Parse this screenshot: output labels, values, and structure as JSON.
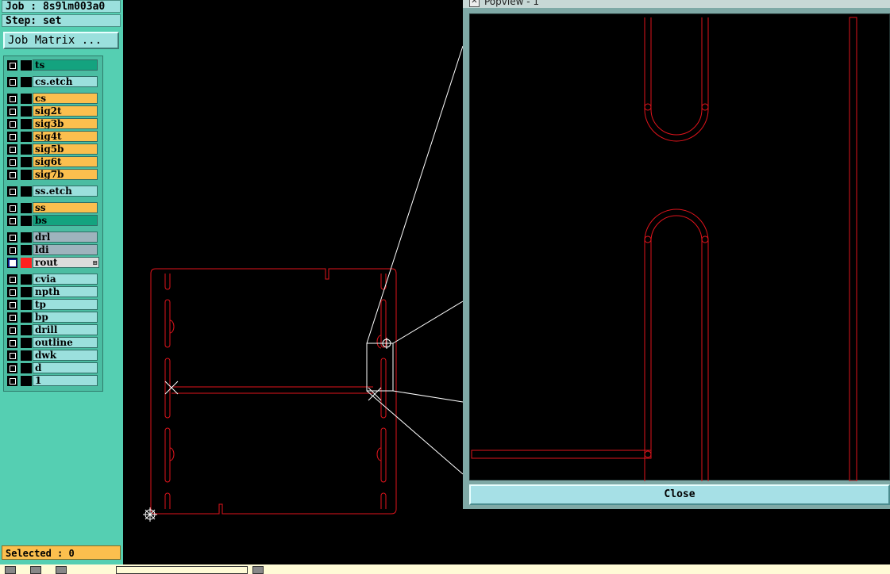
{
  "left_panel": {
    "job_label": "Job : 8s9lm003a0",
    "step_label": "Step: set",
    "job_matrix_label": "Job Matrix ...",
    "selected_label": "Selected : 0"
  },
  "layers": [
    {
      "name": "ts",
      "color": "#14a37f",
      "active": false
    },
    {
      "name": "cs.etch",
      "color": "#9be0dd",
      "active": false
    },
    {
      "name": "cs",
      "color": "#fbbf4e",
      "active": false
    },
    {
      "name": "sig2t",
      "color": "#fbbf4e",
      "active": false
    },
    {
      "name": "sig3b",
      "color": "#fbbf4e",
      "active": false
    },
    {
      "name": "sig4t",
      "color": "#fbbf4e",
      "active": false
    },
    {
      "name": "sig5b",
      "color": "#fbbf4e",
      "active": false
    },
    {
      "name": "sig6t",
      "color": "#fbbf4e",
      "active": false
    },
    {
      "name": "sig7b",
      "color": "#fbbf4e",
      "active": false
    },
    {
      "name": "ss.etch",
      "color": "#9be0dd",
      "active": false
    },
    {
      "name": "ss",
      "color": "#fbbf4e",
      "active": false
    },
    {
      "name": "bs",
      "color": "#14a37f",
      "active": false
    },
    {
      "name": "drl",
      "color": "#9eb3bd",
      "active": false
    },
    {
      "name": "ldi",
      "color": "#9eb3bd",
      "active": false
    },
    {
      "name": "rout",
      "color": "#dcdcdc",
      "active": true,
      "swatch": "#ff2020"
    },
    {
      "name": "cvia",
      "color": "#9be0dd",
      "active": false
    },
    {
      "name": "npth",
      "color": "#9be0dd",
      "active": false
    },
    {
      "name": "tp",
      "color": "#9be0dd",
      "active": false
    },
    {
      "name": "bp",
      "color": "#9be0dd",
      "active": false
    },
    {
      "name": "drill",
      "color": "#9be0dd",
      "active": false
    },
    {
      "name": "outline",
      "color": "#9be0dd",
      "active": false
    },
    {
      "name": "dwk",
      "color": "#9be0dd",
      "active": false
    },
    {
      "name": "d",
      "color": "#9be0dd",
      "active": false
    },
    {
      "name": "1",
      "color": "#9be0dd",
      "active": false
    }
  ],
  "popview": {
    "title": "Popview - 1",
    "close_label": "Close"
  },
  "colors": {
    "rout_line": "#e0141c",
    "zoom_line": "#ffffff"
  }
}
